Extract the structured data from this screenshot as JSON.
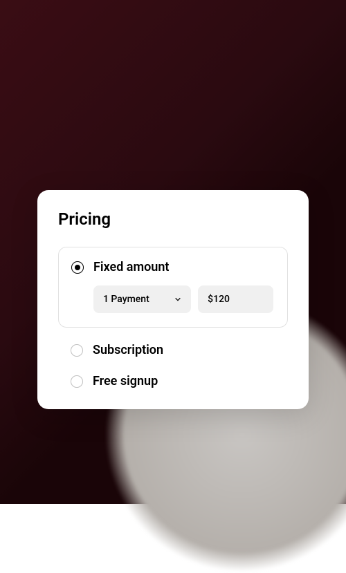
{
  "card": {
    "title": "Pricing"
  },
  "options": {
    "fixed": {
      "label": "Fixed amount",
      "payments": "1 Payment",
      "amount": "$120"
    },
    "subscription": {
      "label": "Subscription"
    },
    "free": {
      "label": "Free signup"
    }
  }
}
